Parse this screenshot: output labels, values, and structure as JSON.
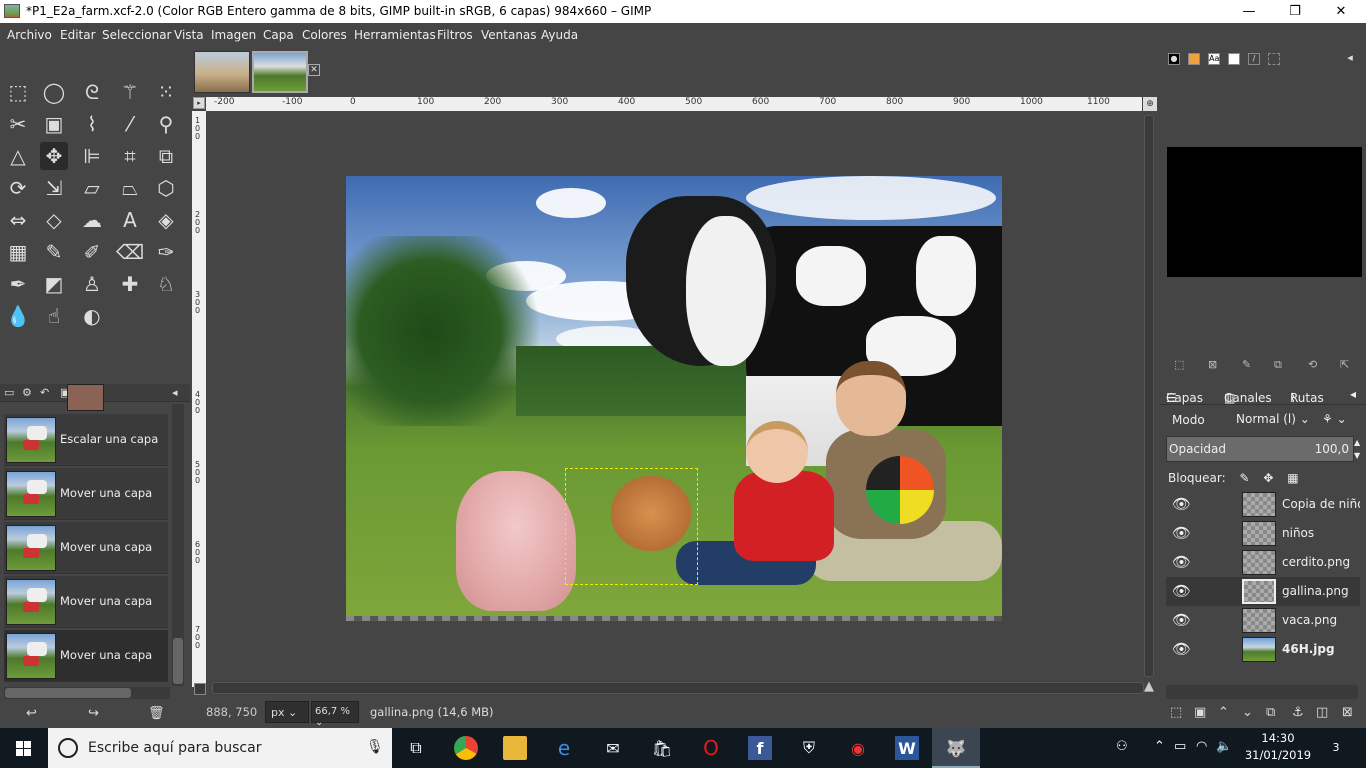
{
  "window": {
    "title": "*P1_E2a_farm.xcf-2.0 (Color RGB Entero gamma de 8 bits, GIMP built-in sRGB, 6 capas) 984x660 – GIMP",
    "minimize": "—",
    "maximize": "❐",
    "close": "✕"
  },
  "menu": [
    "Archivo",
    "Editar",
    "Seleccionar",
    "Vista",
    "Imagen",
    "Capa",
    "Colores",
    "Herramientas",
    "Filtros",
    "Ventanas",
    "Ayuda"
  ],
  "colors": {
    "foreground": "#8b6354",
    "background": "#5c4c40",
    "accent": "#454545"
  },
  "history": {
    "items": [
      {
        "label": "Escalar una capa",
        "selected": false
      },
      {
        "label": "Mover una capa",
        "selected": false
      },
      {
        "label": "Mover una capa",
        "selected": false
      },
      {
        "label": "Mover una capa",
        "selected": false
      },
      {
        "label": "Mover una capa",
        "selected": true
      }
    ]
  },
  "ruler": {
    "h_ticks": [
      "-200",
      "-100",
      "0",
      "100",
      "200",
      "300",
      "400",
      "500",
      "600",
      "700",
      "800",
      "900",
      "1000",
      "1100"
    ],
    "v_ticks": [
      "1 0 0",
      "2 0 0",
      "3 0 0",
      "4 0 0",
      "5 0 0",
      "6 0 0",
      "7 0 0"
    ]
  },
  "status": {
    "coords": "888, 750",
    "unit": "px",
    "zoom": "66,7 %",
    "info": "gallina.png (14,6 MB)"
  },
  "layers": {
    "tabs": [
      "Capas",
      "Canales",
      "Rutas"
    ],
    "mode_label": "Modo",
    "mode_value": "Normal (l)",
    "opacity_label": "Opacidad",
    "opacity_value": "100,0",
    "lock_label": "Bloquear:",
    "items": [
      {
        "name": "Copia de niños",
        "selected": false,
        "bold": false
      },
      {
        "name": "niños",
        "selected": false,
        "bold": false
      },
      {
        "name": "cerdito.png",
        "selected": false,
        "bold": false
      },
      {
        "name": "gallina.png",
        "selected": true,
        "bold": false
      },
      {
        "name": "vaca.png",
        "selected": false,
        "bold": false
      },
      {
        "name": "46H.jpg",
        "selected": false,
        "bold": true
      }
    ]
  },
  "taskbar": {
    "search_placeholder": "Escribe aquí para buscar",
    "time": "14:30",
    "date": "31/01/2019",
    "notifications": "3"
  }
}
